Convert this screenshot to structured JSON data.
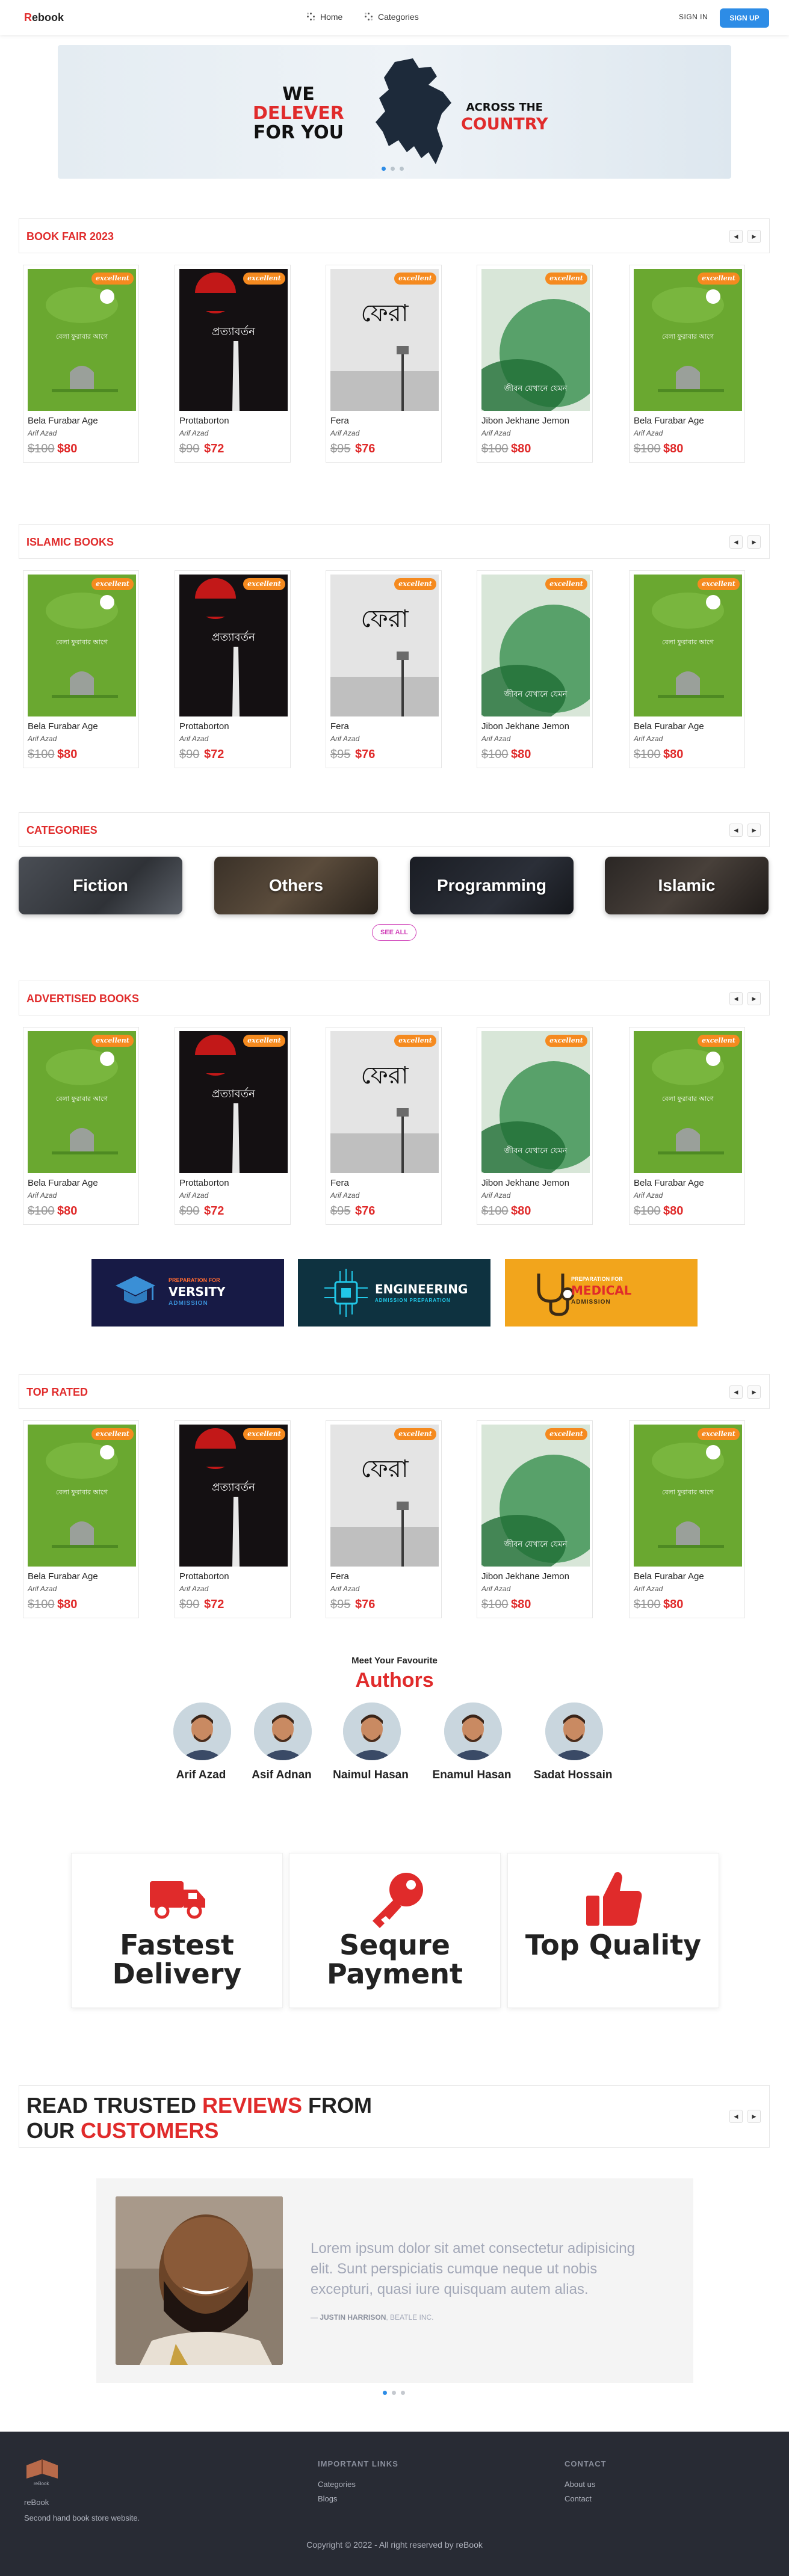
{
  "nav": {
    "logo_first": "R",
    "logo_rest": "ebook",
    "home": "Home",
    "categories": "Categories",
    "sign_in": "SIGN IN",
    "sign_up": "SIGN UP"
  },
  "hero": {
    "left_line1": "WE",
    "left_line2": "DELEVER",
    "left_line3": "FOR YOU",
    "right_line1": "ACROSS THE",
    "right_line2": "COUNTRY",
    "slide_count": 3,
    "active_slide": 1
  },
  "sections": {
    "book_fair": "BOOK FAIR 2023",
    "islamic": "ISLAMIC BOOKS",
    "categories": "CATEGORIES",
    "advertised": "ADVERTISED BOOKS",
    "top_rated": "TOP RATED"
  },
  "badge": "excellent",
  "books": [
    {
      "title": "Bela Furabar Age",
      "author": "Arif Azad",
      "old_price": "$100",
      "price": "$80",
      "cover": "green-tombstone",
      "cover_text": "বেলা ফুরাবার আগে"
    },
    {
      "title": "Prottaborton",
      "author": "Arif Azad",
      "old_price": "$90",
      "price": "$72",
      "cover": "dark-red",
      "cover_text": "প্রত্যাবর্তন"
    },
    {
      "title": "Fera",
      "author": "Arif Azad",
      "old_price": "$95",
      "price": "$76",
      "cover": "grey-lamp",
      "cover_text": "ফেরা"
    },
    {
      "title": "Jibon Jekhane Jemon",
      "author": "Arif Azad",
      "old_price": "$100",
      "price": "$80",
      "cover": "green-mist",
      "cover_text": "জীবন যেখানে যেমন"
    },
    {
      "title": "Bela Furabar Age",
      "author": "Arif Azad",
      "old_price": "$100",
      "price": "$80",
      "cover": "green-tombstone",
      "cover_text": "বেলা ফুরাবার আগে"
    }
  ],
  "categories": [
    "Fiction",
    "Others",
    "Programming",
    "Islamic"
  ],
  "see_all": "SEE ALL",
  "admission": [
    {
      "small": "PREPARATION FOR",
      "big": "VERSITY",
      "sub": "ADMISSION"
    },
    {
      "big": "ENGINEERING",
      "sub": "ADMISSION PREPARATION"
    },
    {
      "small": "PREPARATION FOR",
      "big": "MEDICAL",
      "sub": "ADMISSION"
    }
  ],
  "authors_section": {
    "pre": "Meet Your Favourite",
    "title": "Authors",
    "names": [
      "Arif Azad",
      "Asif Adnan",
      "Naimul Hasan",
      "Enamul Hasan",
      "Sadat Hossain"
    ]
  },
  "features": [
    {
      "line1": "Fastest",
      "line2": "Delivery",
      "icon": "truck-icon"
    },
    {
      "line1": "Sequre",
      "line2": "Payment",
      "icon": "key-icon"
    },
    {
      "line1": "Top Quality",
      "line2": "",
      "icon": "thumbs-up-icon"
    }
  ],
  "reviews": {
    "title_a": "READ TRUSTED ",
    "title_b": "REVIEWS",
    "title_c": " FROM",
    "title_d": "OUR ",
    "title_e": "CUSTOMERS",
    "text": "Lorem ipsum dolor sit amet consectetur adipisicing elit. Sunt perspiciatis cumque neque ut nobis excepturi, quasi iure quisquam autem alias.",
    "dash": "— ",
    "name": "JUSTIN HARRISON",
    "company": ", BEATLE INC.",
    "slide_count": 3,
    "active_slide": 1
  },
  "footer": {
    "brand": "reBook",
    "tagline": "Second hand book store website.",
    "logo_caption": "reBook",
    "links_head": "IMPORTANT LINKS",
    "links": [
      "Categories",
      "Blogs"
    ],
    "contact_head": "CONTACT",
    "contact": [
      "About us",
      "Contact"
    ],
    "copyright": "Copyright © 2022 - All right reserved by reBook"
  },
  "colors": {
    "accent_red": "#e02b2b",
    "primary_blue": "#2d8ce6",
    "badge_orange": "#f58a1f",
    "footer_bg": "#282b34"
  }
}
